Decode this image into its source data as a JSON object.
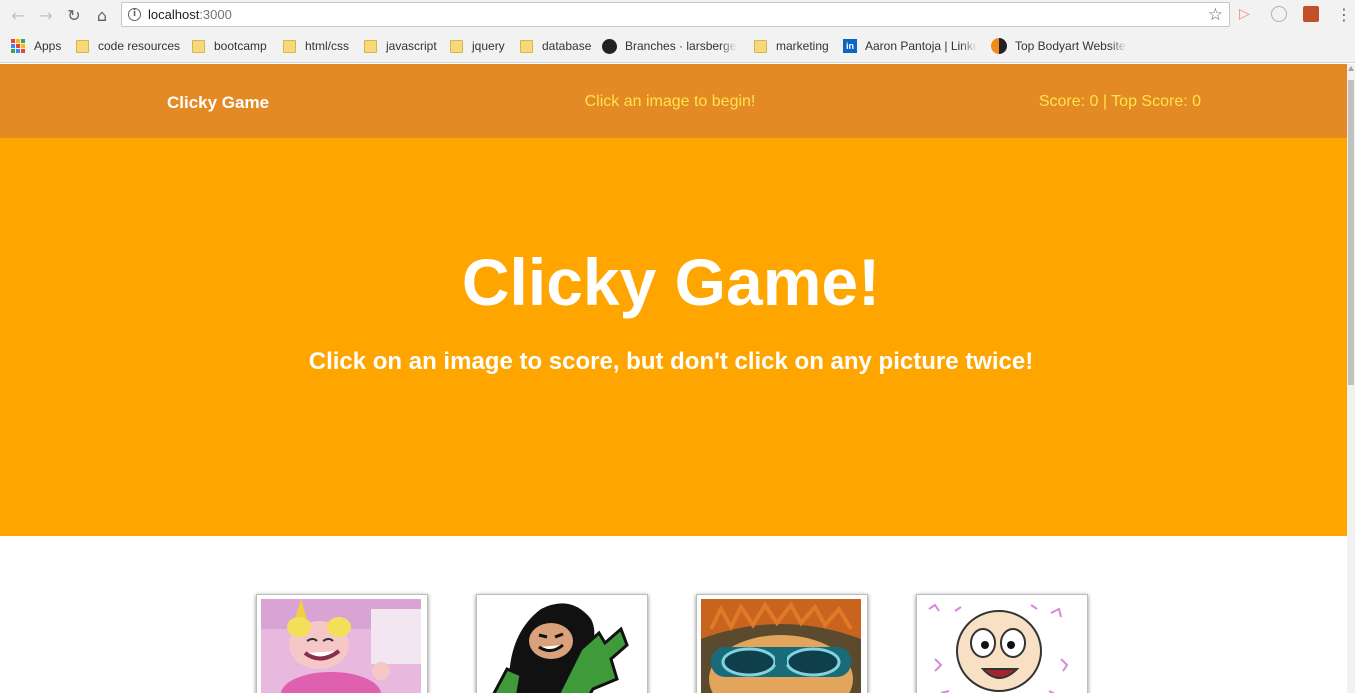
{
  "browser": {
    "url_host": "localhost",
    "url_port": ":3000",
    "bookmarks": [
      {
        "label": "Apps",
        "icon": "apps-grid-icon"
      },
      {
        "label": "code resources",
        "icon": "folder-icon"
      },
      {
        "label": "bootcamp",
        "icon": "folder-icon"
      },
      {
        "label": "html/css",
        "icon": "folder-icon"
      },
      {
        "label": "javascript",
        "icon": "folder-icon"
      },
      {
        "label": "jquery",
        "icon": "folder-icon"
      },
      {
        "label": "database",
        "icon": "folder-icon"
      },
      {
        "label": "Branches · larsbergen",
        "icon": "github-icon"
      },
      {
        "label": "marketing",
        "icon": "folder-icon"
      },
      {
        "label": "Aaron Pantoja | Linke",
        "icon": "linkedin-icon"
      },
      {
        "label": "Top Bodyart Websites",
        "icon": "site-icon"
      }
    ]
  },
  "app": {
    "brand": "Clicky Game",
    "message": "Click an image to begin!",
    "score_text": "Score: 0 | Top Score: 0",
    "colors": {
      "navbar": "#e38a25",
      "jumbotron": "#ffa500",
      "accent_text": "#ffe34d"
    }
  },
  "hero": {
    "title": "Clicky Game!",
    "subtitle": "Click on an image to score, but don't click on any picture twice!"
  },
  "cards": [
    {
      "name": "dee-dee-card"
    },
    {
      "name": "kimi-card"
    },
    {
      "name": "chuckie-card"
    },
    {
      "name": "tommy-card"
    }
  ]
}
